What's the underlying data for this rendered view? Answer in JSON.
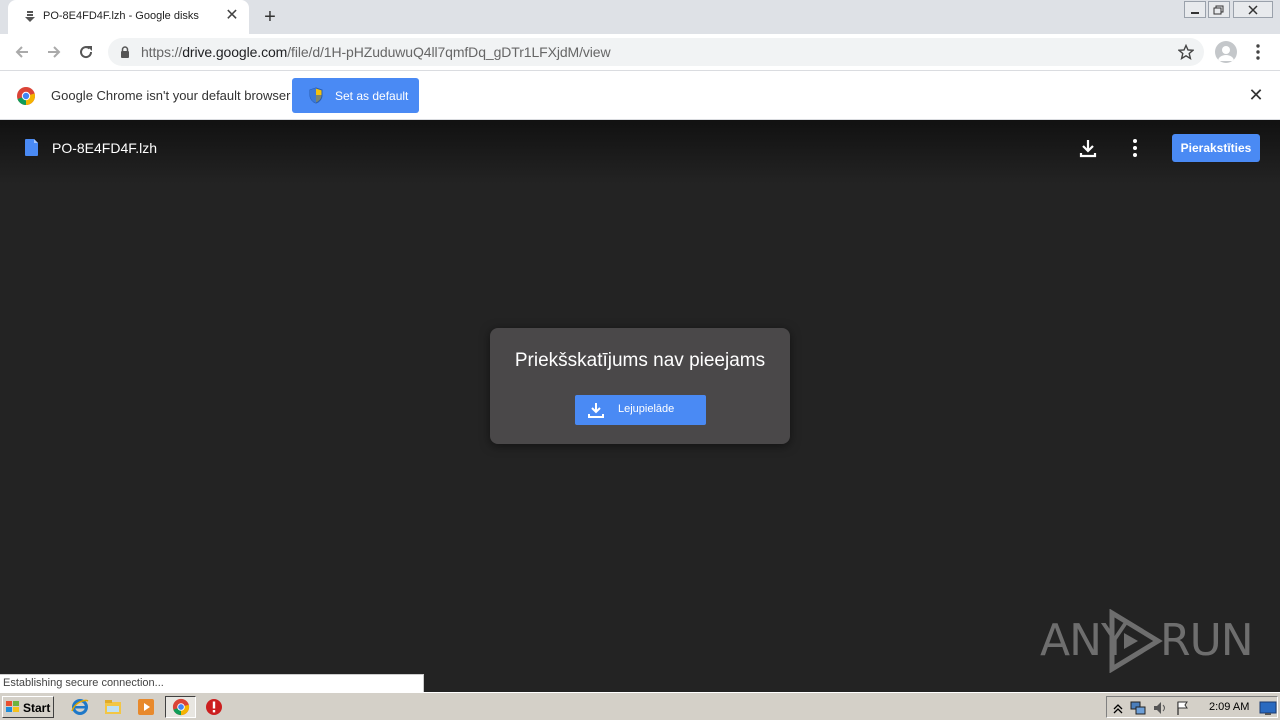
{
  "browser": {
    "tab": {
      "title": "PO-8E4FD4F.lzh - Google disks",
      "close": "✕"
    },
    "new_tab": "+",
    "url": {
      "scheme": "https://",
      "host": "drive.google.com",
      "path": "/file/d/1H-pHZuduwuQ4ll7qmfDq_gDTr1LFXjdM/view"
    }
  },
  "infobar": {
    "message": "Google Chrome isn't your default browser",
    "button_label": "Set as default",
    "close": "✕"
  },
  "viewer": {
    "file_name": "PO-8E4FD4F.lzh",
    "signin_label": "Pierakstīties",
    "dialog_title": "Priekšskatījums nav pieejams",
    "download_label": "Lejupielāde"
  },
  "status_text": "Establishing secure connection...",
  "watermark": {
    "left": "ANY",
    "right": "RUN"
  },
  "taskbar": {
    "start_label": "Start",
    "clock": "2:09 AM"
  },
  "colors": {
    "accent": "#4a8af4",
    "viewer_bg": "#232323",
    "dialog_bg": "#4a4849",
    "taskbar": "#d4d0c8"
  }
}
